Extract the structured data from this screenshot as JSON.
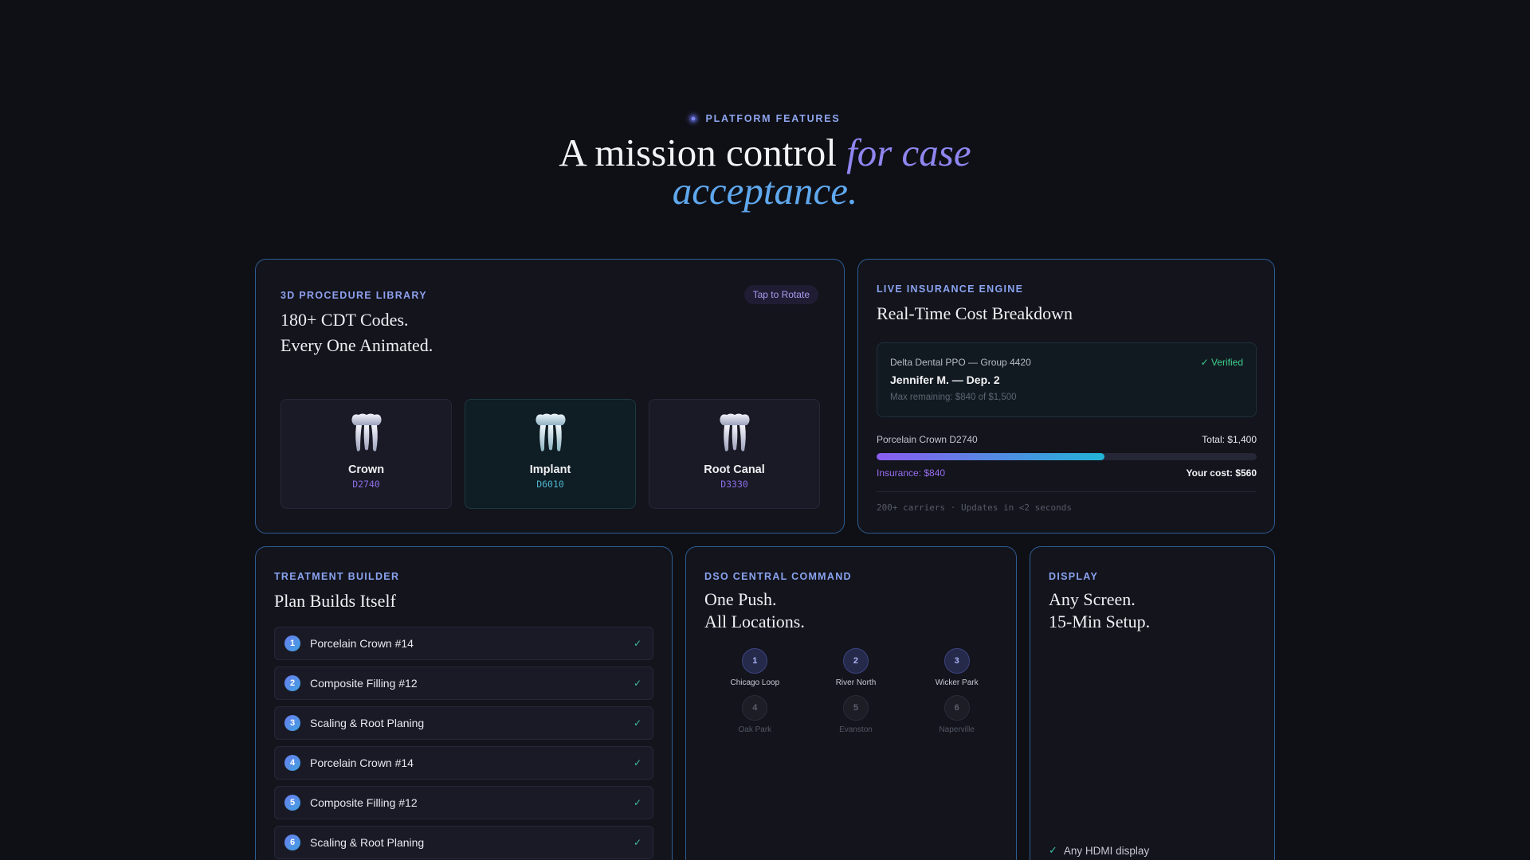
{
  "header": {
    "eyebrow": "PLATFORM FEATURES",
    "headline_plain": "A mission control ",
    "headline_accent_1": "for case",
    "headline_accent_2": "acceptance."
  },
  "procedures": {
    "label": "3D PROCEDURE LIBRARY",
    "title_line_1": "180+ CDT Codes.",
    "title_line_2": "Every One Animated.",
    "rotate_label": "Tap to Rotate",
    "items": [
      {
        "name": "Crown",
        "code": "D2740",
        "icon": "tooth-icon"
      },
      {
        "name": "Implant",
        "code": "D6010",
        "icon": "tooth-icon"
      },
      {
        "name": "Root Canal",
        "code": "D3330",
        "icon": "tooth-icon"
      }
    ],
    "selected": "Implant"
  },
  "insurance": {
    "label": "LIVE INSURANCE ENGINE",
    "title": "Real-Time Cost Breakdown",
    "plan": "Delta Dental PPO — Group 4420",
    "verified": "✓ Verified",
    "patient": "Jennifer M. — Dep. 2",
    "max_remaining": "Max remaining: $840 of $1,500",
    "procedure": "Porcelain Crown D2740",
    "total": "Total: $1,400",
    "insurance_share": "Insurance: $840",
    "your_cost": "Your cost: $560",
    "insurance_fraction": 0.6,
    "footer": "200+ carriers · Updates in <2 seconds"
  },
  "treatment": {
    "label": "TREATMENT BUILDER",
    "title": "Plan Builds Itself",
    "steps": [
      {
        "num": "1",
        "label": "Porcelain Crown #14",
        "check": "✓"
      },
      {
        "num": "2",
        "label": "Composite Filling #12",
        "check": "✓"
      },
      {
        "num": "3",
        "label": "Scaling & Root Planing",
        "check": "✓"
      },
      {
        "num": "4",
        "label": "Porcelain Crown #14",
        "check": "✓"
      },
      {
        "num": "5",
        "label": "Composite Filling #12",
        "check": "✓"
      },
      {
        "num": "6",
        "label": "Scaling & Root Planing",
        "check": "✓"
      }
    ]
  },
  "dso": {
    "label": "DSO CENTRAL COMMAND",
    "title_line_1": "One Push.",
    "title_line_2": "All Locations.",
    "locations": [
      {
        "num": "1",
        "name": "Chicago Loop",
        "active": true
      },
      {
        "num": "2",
        "name": "River North",
        "active": true
      },
      {
        "num": "3",
        "name": "Wicker Park",
        "active": true
      },
      {
        "num": "4",
        "name": "Oak Park",
        "active": false
      },
      {
        "num": "5",
        "name": "Evanston",
        "active": false
      },
      {
        "num": "6",
        "name": "Naperville",
        "active": false
      }
    ]
  },
  "display": {
    "label": "DISPLAY",
    "title_line_1": "Any Screen.",
    "title_line_2": "15-Min Setup.",
    "item": "Any HDMI display",
    "item_check": "✓"
  },
  "colors": {
    "background": "#0f1016",
    "card_border": "#2e5d93",
    "accent_purple": "#8f86f0",
    "accent_blue": "#5fa8ee",
    "success_green": "#3fcf8e"
  }
}
